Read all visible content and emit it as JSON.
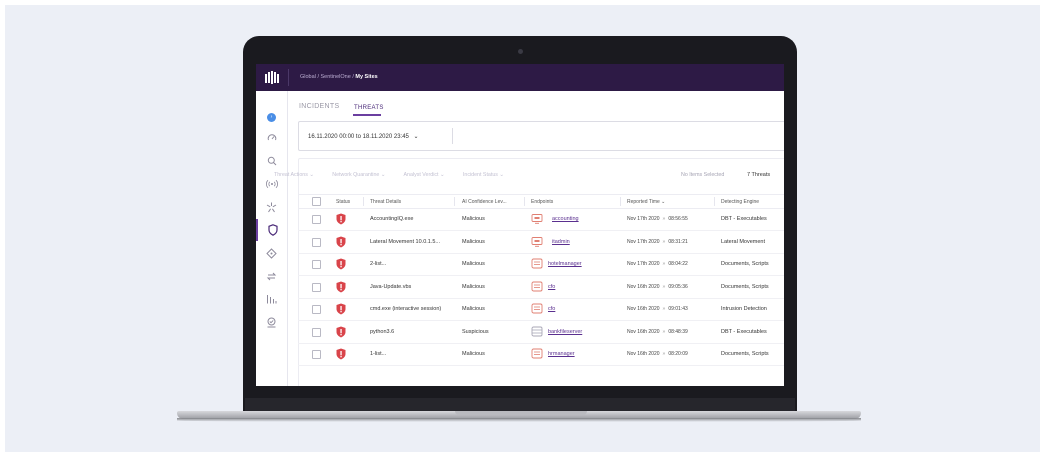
{
  "breadcrumb": {
    "part1": "Global",
    "part2": "SentinelOne",
    "current": "My Sites",
    "sep": "/"
  },
  "tabs": {
    "incidents": "INCIDENTS",
    "threats": "THREATS"
  },
  "date_range": {
    "value": "16.11.2020 00:00 to 18.11.2020 23:45",
    "chevron": "⌄"
  },
  "actions": {
    "threat_actions": "Threat Actions ⌄",
    "network_quarantine": "Network Quarantine ⌄",
    "analyst_verdict": "Analyst Verdict ⌄",
    "incident_status": "Incident Status ⌄"
  },
  "selection": {
    "no_items": "No Items Selected",
    "count": "7 Threats"
  },
  "columns": [
    "Status",
    "Threat Details",
    "AI Confidence Lev...",
    "Endpoints",
    "Reported Time ⌄",
    "Detecting Engine"
  ],
  "rows": [
    {
      "threat": "AccountingIQ.exe",
      "confidence": "Malicious",
      "endpoint": "accounting",
      "endpoint_icon": "desktop-icon",
      "date": "Nov 17th 2020",
      "time": "08:56:55",
      "engine": "DBT - Executables"
    },
    {
      "threat": "Lateral Movement 10.0.1.5...",
      "confidence": "Malicious",
      "endpoint": "itadmin",
      "endpoint_icon": "desktop-icon",
      "date": "Nov 17th 2020",
      "time": "08:31:21",
      "engine": "Lateral Movement"
    },
    {
      "threat": "2-list...",
      "confidence": "Malicious",
      "endpoint": "hotelmanager",
      "endpoint_icon": "monitor-icon",
      "date": "Nov 17th 2020",
      "time": "08:04:22",
      "engine": "Documents, Scripts"
    },
    {
      "threat": "Java-Update.vbs",
      "confidence": "Malicious",
      "endpoint": "cfo",
      "endpoint_icon": "monitor-icon",
      "date": "Nov 16th 2020",
      "time": "09:05:36",
      "engine": "Documents, Scripts"
    },
    {
      "threat": "cmd.exe (interactive session)",
      "confidence": "Malicious",
      "endpoint": "cfo",
      "endpoint_icon": "monitor-icon",
      "date": "Nov 16th 2020",
      "time": "09:01:43",
      "engine": "Intrusion Detection"
    },
    {
      "threat": "python3.6",
      "confidence": "Suspicious",
      "endpoint": "bankfileserver",
      "endpoint_icon": "server-icon",
      "date": "Nov 16th 2020",
      "time": "08:48:39",
      "engine": "DBT - Executables"
    },
    {
      "threat": "1-list...",
      "confidence": "Malicious",
      "endpoint": "hrmanager",
      "endpoint_icon": "monitor-icon",
      "date": "Nov 16th 2020",
      "time": "08:20:09",
      "engine": "Documents, Scripts"
    }
  ],
  "time_sep": "»",
  "colors": {
    "topbar": "#2d1a45",
    "accent": "#6b3fa0",
    "threat_red": "#d9444a",
    "link": "#5a2f8f",
    "endpoint_icon": "#e07f72"
  }
}
